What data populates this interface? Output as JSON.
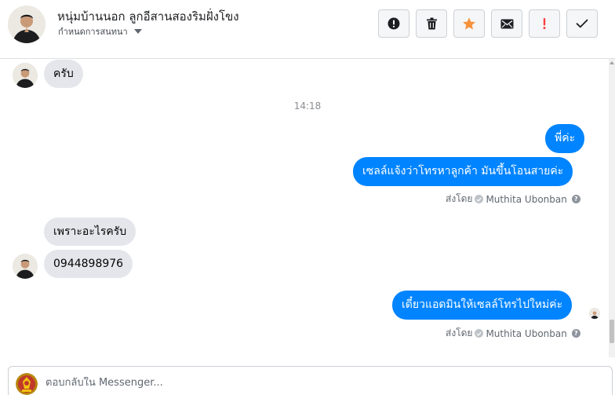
{
  "header": {
    "contact_name": "หนุ่มบ้านนอก ลูกอีสานสองริมฝั่งโขง",
    "subtitle": "กำหนดการสนทนา",
    "buttons": [
      {
        "name": "info-button",
        "icon": "exclamation-circle-icon"
      },
      {
        "name": "delete-button",
        "icon": "trash-icon"
      },
      {
        "name": "star-button",
        "icon": "star-icon",
        "color": "#f7923b"
      },
      {
        "name": "mark-unread-button",
        "icon": "envelope-icon"
      },
      {
        "name": "mark-spam-button",
        "icon": "exclamation-icon",
        "color": "#fa3e3e"
      },
      {
        "name": "mark-done-button",
        "icon": "checkmark-icon"
      }
    ]
  },
  "thread": {
    "messages": [
      {
        "from": "contact",
        "text": "ครับ"
      },
      {
        "timestamp": "14:18"
      },
      {
        "from": "page",
        "text": "พี่ค่ะ"
      },
      {
        "from": "page",
        "text": "เซลล์แจ้งว่าโทรหาลูกค้า มันขึ้นโอนสายค่ะ"
      },
      {
        "sent_by_prefix": "ส่งโดย",
        "sent_by_name": "Muthita Ubonban"
      },
      {
        "from": "contact",
        "text": "เพราะอะไรครับ"
      },
      {
        "from": "contact",
        "text": "0944898976"
      },
      {
        "from": "page",
        "text": "เดี๋ยวแอดมินให้เซลล์โทรไปใหม่ค่ะ"
      },
      {
        "sent_by_prefix": "ส่งโดย",
        "sent_by_name": "Muthita Ubonban"
      }
    ]
  },
  "composer": {
    "placeholder": "ตอบกลับใน Messenger..."
  },
  "colors": {
    "outgoing_bubble": "#0084ff",
    "incoming_bubble": "#e4e6eb",
    "star": "#f7923b",
    "spam": "#fa3e3e"
  }
}
